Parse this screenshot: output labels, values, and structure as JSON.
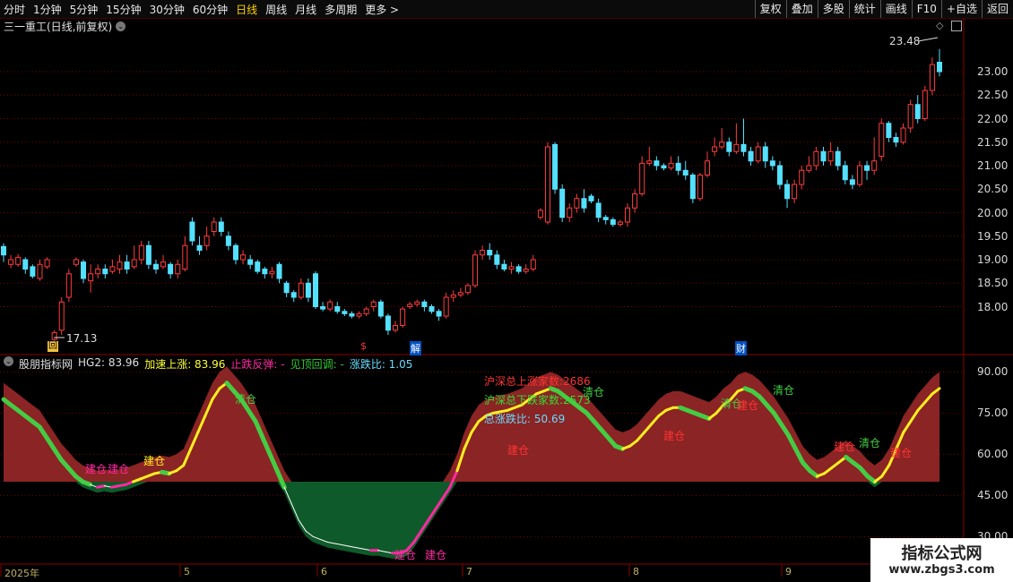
{
  "toolbar": {
    "periods": [
      "分时",
      "1分钟",
      "5分钟",
      "15分钟",
      "30分钟",
      "60分钟",
      "日线",
      "周线",
      "月线",
      "多周期",
      "更多 >"
    ],
    "active_period": "日线",
    "right_buttons": [
      "复权",
      "叠加",
      "多股",
      "统计",
      "画线",
      "F10",
      "+自选",
      "返回"
    ]
  },
  "chart_title": "三一重工(日线,前复权)",
  "indicator": {
    "name": "股朋指标网",
    "hg2": "HG2: 83.96",
    "accel": "加速上涨: 83.96",
    "stop_fall": "止跌反弹: -",
    "top_pullback": "见顶回调: -",
    "ratio": "涨跌比: 1.05",
    "up_count": "沪深总上涨家数:2686",
    "down_count": "沪深总下跌家数:2573",
    "total_ratio": "总涨跌比: 50.69",
    "label_position": "建仓",
    "label_clear": "清仓"
  },
  "price_axis": [
    "23.00",
    "22.50",
    "22.00",
    "21.50",
    "21.00",
    "20.50",
    "20.00",
    "19.50",
    "19.00",
    "18.50",
    "18.00"
  ],
  "indicator_axis": [
    "90.00",
    "75.00",
    "60.00",
    "45.00",
    "30.00"
  ],
  "price_high_label": "23.48",
  "price_low_label": "17.13",
  "markers": {
    "m1": "回",
    "m2": "$",
    "m3": "解",
    "m4": "财"
  },
  "dates": [
    "2025年",
    "5",
    "6",
    "7",
    "8",
    "9"
  ],
  "colors": {
    "up": "#ff3c3c",
    "down": "#54e0ff",
    "bg": "#000000",
    "grid": "#7a0000"
  },
  "watermark": {
    "line1": "指标公式网",
    "line2": "www.zbgs3.com"
  },
  "chart_data": {
    "type": "candlestick",
    "ylim": [
      17.0,
      23.8
    ],
    "candles": [
      [
        19.28,
        19.1,
        19.35,
        18.95
      ],
      [
        18.9,
        19.0,
        19.1,
        18.82
      ],
      [
        18.9,
        19.05,
        19.12,
        18.85
      ],
      [
        19.0,
        18.8,
        19.05,
        18.7
      ],
      [
        18.85,
        18.65,
        18.9,
        18.6
      ],
      [
        18.6,
        18.9,
        19.0,
        18.55
      ],
      [
        18.85,
        19.0,
        19.05,
        18.8
      ],
      [
        17.3,
        17.45,
        17.5,
        17.13
      ],
      [
        17.5,
        18.1,
        18.2,
        17.4
      ],
      [
        18.2,
        18.7,
        18.8,
        18.1
      ],
      [
        18.9,
        19.0,
        19.05,
        18.85
      ],
      [
        18.95,
        18.6,
        19.0,
        18.5
      ],
      [
        18.55,
        18.7,
        18.9,
        18.3
      ],
      [
        18.7,
        18.8,
        18.9,
        18.6
      ],
      [
        18.8,
        18.7,
        18.9,
        18.6
      ],
      [
        18.75,
        18.85,
        19.0,
        18.7
      ],
      [
        18.8,
        18.95,
        19.1,
        18.7
      ],
      [
        18.95,
        18.8,
        19.1,
        18.7
      ],
      [
        18.85,
        19.0,
        19.3,
        18.8
      ],
      [
        19.0,
        19.3,
        19.4,
        18.9
      ],
      [
        19.3,
        18.9,
        19.4,
        18.8
      ],
      [
        18.9,
        18.8,
        19.0,
        18.7
      ],
      [
        18.85,
        18.95,
        19.1,
        18.8
      ],
      [
        18.9,
        18.7,
        18.95,
        18.6
      ],
      [
        18.7,
        18.9,
        19.0,
        18.6
      ],
      [
        18.8,
        19.3,
        19.5,
        18.75
      ],
      [
        19.8,
        19.4,
        19.9,
        19.3
      ],
      [
        19.3,
        19.2,
        19.5,
        19.1
      ],
      [
        19.3,
        19.5,
        19.7,
        19.2
      ],
      [
        19.6,
        19.8,
        19.9,
        19.5
      ],
      [
        19.8,
        19.6,
        19.9,
        19.5
      ],
      [
        19.5,
        19.3,
        19.6,
        19.2
      ],
      [
        19.3,
        19.0,
        19.35,
        18.9
      ],
      [
        19.0,
        19.1,
        19.2,
        18.9
      ],
      [
        19.0,
        18.9,
        19.1,
        18.8
      ],
      [
        18.95,
        18.75,
        19.0,
        18.7
      ],
      [
        18.8,
        18.7,
        18.85,
        18.6
      ],
      [
        18.7,
        18.75,
        18.85,
        18.6
      ],
      [
        18.9,
        18.6,
        18.95,
        18.5
      ],
      [
        18.5,
        18.3,
        18.55,
        18.2
      ],
      [
        18.3,
        18.2,
        18.35,
        18.1
      ],
      [
        18.2,
        18.5,
        18.6,
        18.15
      ],
      [
        18.5,
        18.2,
        18.6,
        18.1
      ],
      [
        18.7,
        18.0,
        18.75,
        17.95
      ],
      [
        18.0,
        17.95,
        18.1,
        17.9
      ],
      [
        17.95,
        18.1,
        18.15,
        17.9
      ],
      [
        18.0,
        17.9,
        18.1,
        17.85
      ],
      [
        17.9,
        17.85,
        17.95,
        17.8
      ],
      [
        17.85,
        17.8,
        17.9,
        17.75
      ],
      [
        17.8,
        17.85,
        17.9,
        17.75
      ],
      [
        17.85,
        17.95,
        18.0,
        17.8
      ],
      [
        18.0,
        18.1,
        18.15,
        17.9
      ],
      [
        18.1,
        17.8,
        18.15,
        17.75
      ],
      [
        17.8,
        17.5,
        17.85,
        17.4
      ],
      [
        17.5,
        17.6,
        17.7,
        17.45
      ],
      [
        17.6,
        17.95,
        18.0,
        17.55
      ],
      [
        18.0,
        18.05,
        18.1,
        17.95
      ],
      [
        18.05,
        18.1,
        18.15,
        18.0
      ],
      [
        18.1,
        18.0,
        18.15,
        17.9
      ],
      [
        18.0,
        17.9,
        18.05,
        17.85
      ],
      [
        17.9,
        17.8,
        17.95,
        17.7
      ],
      [
        17.8,
        18.2,
        18.3,
        17.75
      ],
      [
        18.2,
        18.25,
        18.35,
        18.1
      ],
      [
        18.25,
        18.3,
        18.4,
        18.2
      ],
      [
        18.3,
        18.45,
        18.5,
        18.25
      ],
      [
        18.45,
        19.1,
        19.2,
        18.4
      ],
      [
        19.1,
        19.2,
        19.3,
        19.0
      ],
      [
        19.2,
        19.1,
        19.35,
        19.0
      ],
      [
        19.1,
        18.9,
        19.2,
        18.8
      ],
      [
        18.9,
        18.8,
        19.0,
        18.75
      ],
      [
        18.8,
        18.85,
        18.95,
        18.7
      ],
      [
        18.85,
        18.75,
        18.9,
        18.7
      ],
      [
        18.75,
        18.8,
        18.9,
        18.7
      ],
      [
        18.8,
        19.0,
        19.1,
        18.75
      ],
      [
        19.9,
        20.05,
        20.1,
        19.85
      ],
      [
        19.8,
        21.4,
        21.5,
        19.75
      ],
      [
        21.45,
        20.5,
        21.5,
        20.4
      ],
      [
        20.5,
        19.9,
        20.6,
        19.8
      ],
      [
        19.9,
        20.1,
        20.2,
        19.8
      ],
      [
        20.1,
        20.3,
        20.4,
        20.0
      ],
      [
        20.3,
        20.1,
        20.5,
        20.0
      ],
      [
        20.35,
        20.25,
        20.4,
        20.2
      ],
      [
        20.2,
        19.9,
        20.3,
        19.8
      ],
      [
        19.9,
        19.85,
        19.95,
        19.75
      ],
      [
        19.85,
        19.75,
        19.9,
        19.7
      ],
      [
        19.75,
        19.8,
        19.85,
        19.7
      ],
      [
        19.8,
        20.1,
        20.2,
        19.7
      ],
      [
        20.1,
        20.4,
        20.5,
        20.0
      ],
      [
        20.4,
        21.05,
        21.2,
        20.35
      ],
      [
        21.05,
        21.1,
        21.4,
        21.0
      ],
      [
        21.1,
        21.0,
        21.2,
        20.9
      ],
      [
        21.0,
        20.95,
        21.05,
        20.9
      ],
      [
        20.95,
        21.05,
        21.2,
        20.9
      ],
      [
        21.05,
        20.9,
        21.2,
        20.8
      ],
      [
        20.9,
        20.8,
        21.1,
        20.7
      ],
      [
        20.8,
        20.3,
        20.85,
        20.2
      ],
      [
        20.3,
        20.8,
        20.85,
        20.25
      ],
      [
        20.8,
        21.1,
        21.3,
        20.75
      ],
      [
        21.3,
        21.4,
        21.6,
        21.2
      ],
      [
        21.4,
        21.5,
        21.8,
        21.35
      ],
      [
        21.5,
        21.3,
        21.6,
        21.2
      ],
      [
        21.3,
        21.45,
        21.9,
        21.25
      ],
      [
        21.45,
        21.3,
        22.0,
        21.2
      ],
      [
        21.3,
        21.1,
        21.4,
        21.0
      ],
      [
        21.1,
        21.4,
        21.5,
        21.05
      ],
      [
        21.4,
        21.1,
        21.5,
        20.95
      ],
      [
        21.1,
        21.0,
        21.2,
        20.9
      ],
      [
        21.0,
        20.6,
        21.1,
        20.5
      ],
      [
        20.6,
        20.3,
        20.7,
        20.1
      ],
      [
        20.3,
        20.6,
        20.7,
        20.2
      ],
      [
        20.6,
        20.9,
        21.0,
        20.5
      ],
      [
        20.9,
        21.0,
        21.2,
        20.85
      ],
      [
        21.0,
        21.3,
        21.4,
        20.9
      ],
      [
        21.3,
        21.1,
        21.4,
        21.0
      ],
      [
        21.1,
        21.3,
        21.5,
        21.0
      ],
      [
        21.3,
        21.0,
        21.4,
        20.9
      ],
      [
        21.0,
        20.7,
        21.1,
        20.6
      ],
      [
        20.7,
        20.6,
        20.8,
        20.5
      ],
      [
        20.6,
        21.0,
        21.1,
        20.55
      ],
      [
        21.0,
        20.9,
        21.1,
        20.7
      ],
      [
        20.9,
        21.1,
        21.6,
        20.8
      ],
      [
        21.2,
        21.9,
        22.0,
        21.1
      ],
      [
        21.9,
        21.6,
        21.95,
        21.5
      ],
      [
        21.6,
        21.5,
        21.7,
        21.4
      ],
      [
        21.5,
        21.8,
        21.9,
        21.45
      ],
      [
        21.8,
        22.3,
        22.4,
        21.7
      ],
      [
        22.3,
        22.0,
        22.5,
        21.9
      ],
      [
        22.0,
        22.6,
        22.7,
        21.95
      ],
      [
        22.6,
        23.15,
        23.3,
        22.5
      ],
      [
        23.2,
        23.0,
        23.48,
        22.9
      ]
    ],
    "indicator": {
      "ylim": [
        20,
        96
      ],
      "baseline": 50,
      "hg2": [
        80,
        78,
        76,
        74,
        72,
        70,
        66,
        62,
        58,
        55,
        52,
        50,
        49,
        48,
        48.5,
        48,
        48.5,
        49,
        50,
        51,
        52,
        53,
        53.5,
        53,
        54,
        56,
        62,
        68,
        74,
        80,
        84,
        86,
        83,
        80,
        76,
        72,
        66,
        60,
        54,
        48,
        42,
        36,
        32,
        30,
        29,
        28,
        27.5,
        27,
        26.5,
        26,
        25.5,
        25,
        25,
        24.5,
        24,
        24,
        25,
        28,
        32,
        36,
        40,
        44,
        48,
        54,
        62,
        68,
        72,
        74,
        75,
        75.5,
        76,
        77,
        78,
        80,
        82,
        83,
        84,
        83,
        81,
        79,
        77,
        75,
        72,
        69,
        66,
        63,
        62,
        63,
        65,
        68,
        71,
        74,
        76,
        77,
        77,
        76,
        75,
        74,
        73,
        75,
        78,
        80,
        83,
        84,
        83,
        81,
        78,
        75,
        71,
        67,
        62,
        57,
        54,
        52,
        53,
        55,
        57,
        59,
        57,
        55,
        52,
        50,
        52,
        56,
        62,
        68,
        72,
        76,
        79,
        82,
        84
      ]
    }
  }
}
